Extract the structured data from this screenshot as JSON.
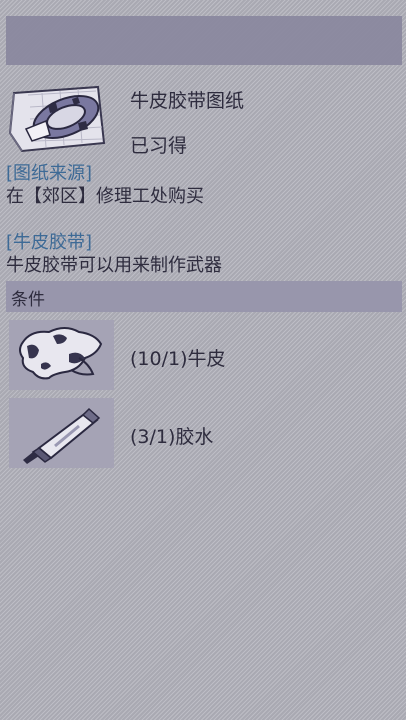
{
  "item": {
    "name": "牛皮胶带图纸",
    "status": "已习得",
    "icon": "leather-tape-blueprint-icon"
  },
  "source": {
    "heading": "[图纸来源]",
    "text": "在【郊区】修理工处购买"
  },
  "description": {
    "heading": "[牛皮胶带]",
    "text": "牛皮胶带可以用来制作武器"
  },
  "conditions": {
    "label": "条件",
    "items": [
      {
        "text": "(10/1)牛皮",
        "icon": "cowhide-icon",
        "have": 10,
        "need": 1
      },
      {
        "text": "(3/1)胶水",
        "icon": "glue-tube-icon",
        "have": 3,
        "need": 1
      }
    ]
  },
  "colors": {
    "heading": "#3d6a96",
    "text": "#2e2c3e",
    "top_bar": "#8a889f",
    "conditions_bar": "#9896ac"
  }
}
